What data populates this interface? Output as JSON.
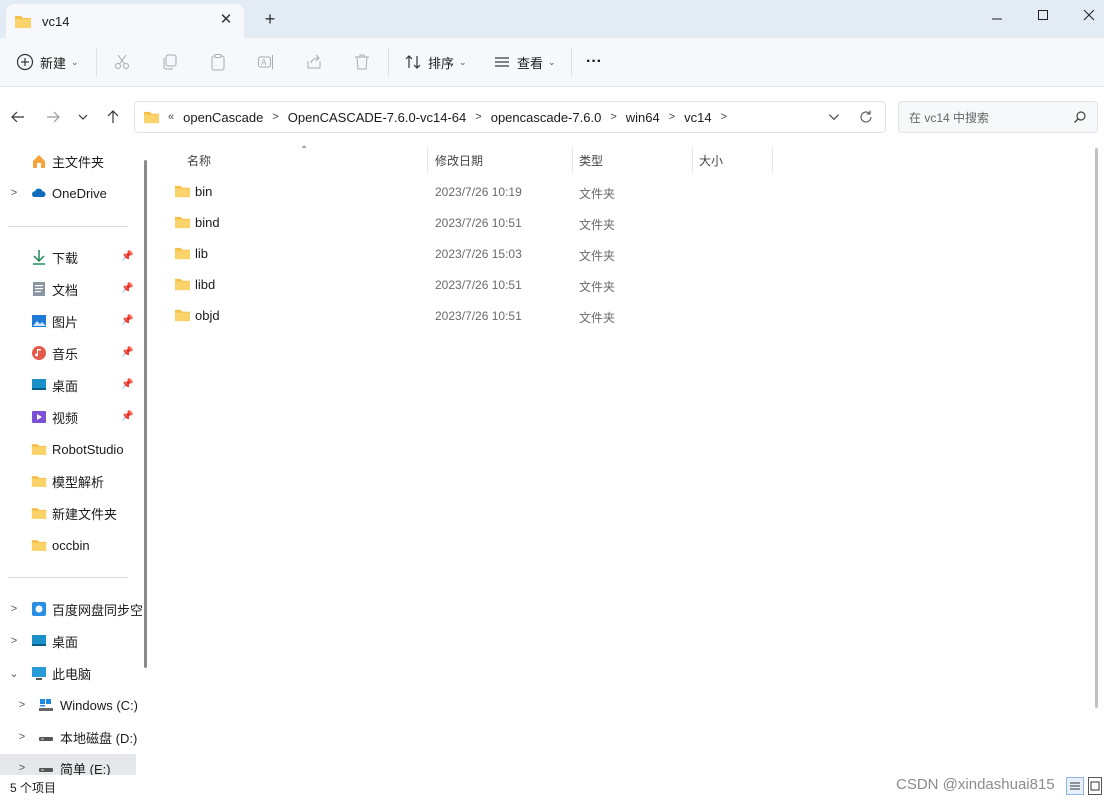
{
  "window": {
    "tab_title": "vc14",
    "new_tab_glyph": "+",
    "close_glyph": "✕",
    "minimize_glyph": "─",
    "maximize_glyph": "☐",
    "window_close_glyph": "✕"
  },
  "commandbar": {
    "new_label": "新建",
    "sort_label": "排序",
    "view_label": "查看",
    "more_glyph": "···",
    "icons": [
      "plus-circle-icon",
      "cut-icon",
      "copy-icon",
      "paste-icon",
      "rename-icon",
      "share-icon",
      "delete-icon",
      "sort-icon",
      "view-icon",
      "more-icon"
    ]
  },
  "address": {
    "overflow": "«",
    "crumbs": [
      "openCascade",
      "OpenCASCADE-7.6.0-vc14-64",
      "opencascade-7.6.0",
      "win64",
      "vc14"
    ],
    "search_placeholder": "在 vc14 中搜索"
  },
  "sidebar": {
    "home": "主文件夹",
    "onedrive": "OneDrive",
    "quick": [
      {
        "label": "下载",
        "icon": "download-icon",
        "pinned": true
      },
      {
        "label": "文档",
        "icon": "document-icon",
        "pinned": true
      },
      {
        "label": "图片",
        "icon": "pictures-icon",
        "pinned": true
      },
      {
        "label": "音乐",
        "icon": "music-icon",
        "pinned": true
      },
      {
        "label": "桌面",
        "icon": "desktop-icon",
        "pinned": true
      },
      {
        "label": "视频",
        "icon": "video-icon",
        "pinned": true
      },
      {
        "label": "RobotStudio",
        "icon": "folder-icon",
        "pinned": false
      },
      {
        "label": "模型解析",
        "icon": "folder-icon",
        "pinned": false
      },
      {
        "label": "新建文件夹",
        "icon": "folder-icon",
        "pinned": false
      },
      {
        "label": "occbin",
        "icon": "folder-icon",
        "pinned": false
      }
    ],
    "baidu": "百度网盘同步空",
    "desktop": "桌面",
    "this_pc": "此电脑",
    "drive_c": "Windows (C:)",
    "drive_d": "本地磁盘 (D:)",
    "drive_e": "简单 (E:)"
  },
  "columns": {
    "name": "名称",
    "modified": "修改日期",
    "type": "类型",
    "size": "大小"
  },
  "files": [
    {
      "name": "bin",
      "modified": "2023/7/26 10:19",
      "type": "文件夹"
    },
    {
      "name": "bind",
      "modified": "2023/7/26 10:51",
      "type": "文件夹"
    },
    {
      "name": "lib",
      "modified": "2023/7/26 15:03",
      "type": "文件夹"
    },
    {
      "name": "libd",
      "modified": "2023/7/26 10:51",
      "type": "文件夹"
    },
    {
      "name": "objd",
      "modified": "2023/7/26 10:51",
      "type": "文件夹"
    }
  ],
  "status": {
    "item_count": "5 个项目"
  },
  "watermark": "CSDN @xindashuai815",
  "colors": {
    "folder": "#f5c04a",
    "folder_dark": "#e3a92f",
    "accent": "#0067c0",
    "titlebar_bg": "#e3ebf5"
  }
}
